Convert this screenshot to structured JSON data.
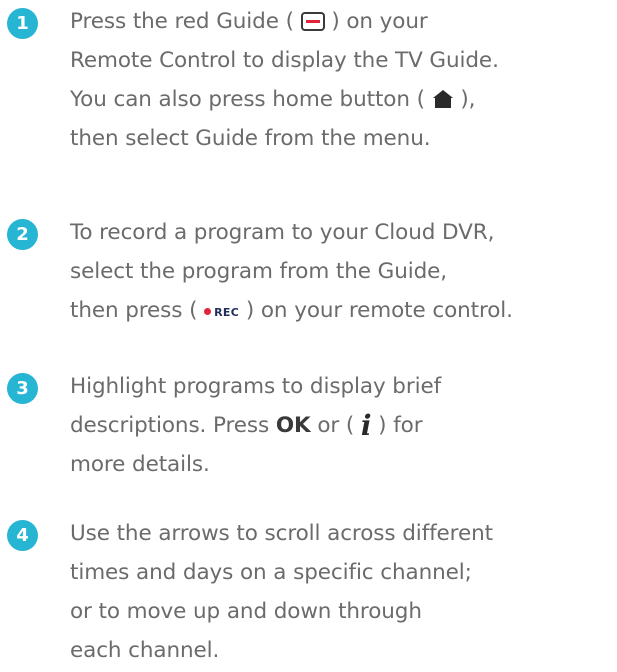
{
  "steps": [
    {
      "number": "1",
      "lines": [
        {
          "before": "Press the red Guide ( ",
          "icon": "guide-button-icon",
          "after": " ) on your"
        },
        {
          "text": "Remote Control to display the TV Guide."
        },
        {
          "before": "You can also press home button  ( ",
          "icon": "home-icon",
          "after": " ),"
        },
        {
          "text": "then select Guide from the menu."
        }
      ]
    },
    {
      "number": "2",
      "lines": [
        {
          "text": "To record a program to your Cloud DVR,"
        },
        {
          "text": "select the program from the Guide,"
        },
        {
          "before": "then press  ( ",
          "icon": "record-button-icon",
          "icon_label": "REC",
          "after": " ) on your remote control."
        }
      ]
    },
    {
      "number": "3",
      "lines": [
        {
          "text": "Highlight programs to display brief"
        },
        {
          "before": "descriptions. Press ",
          "bold": "OK",
          "middle": " or (  ",
          "icon": "info-icon",
          "icon_label": "i",
          "after": "  ) for"
        },
        {
          "text": "more details."
        }
      ]
    },
    {
      "number": "4",
      "lines": [
        {
          "text": "Use the arrows to scroll across different"
        },
        {
          "text": "times and days on a specific channel;"
        },
        {
          "text": "or to move up and down through"
        },
        {
          "text": "each channel."
        }
      ]
    }
  ],
  "colors": {
    "badge": "#27b5d4",
    "body_text": "#6b6b6b",
    "accent_red": "#e0253b"
  }
}
